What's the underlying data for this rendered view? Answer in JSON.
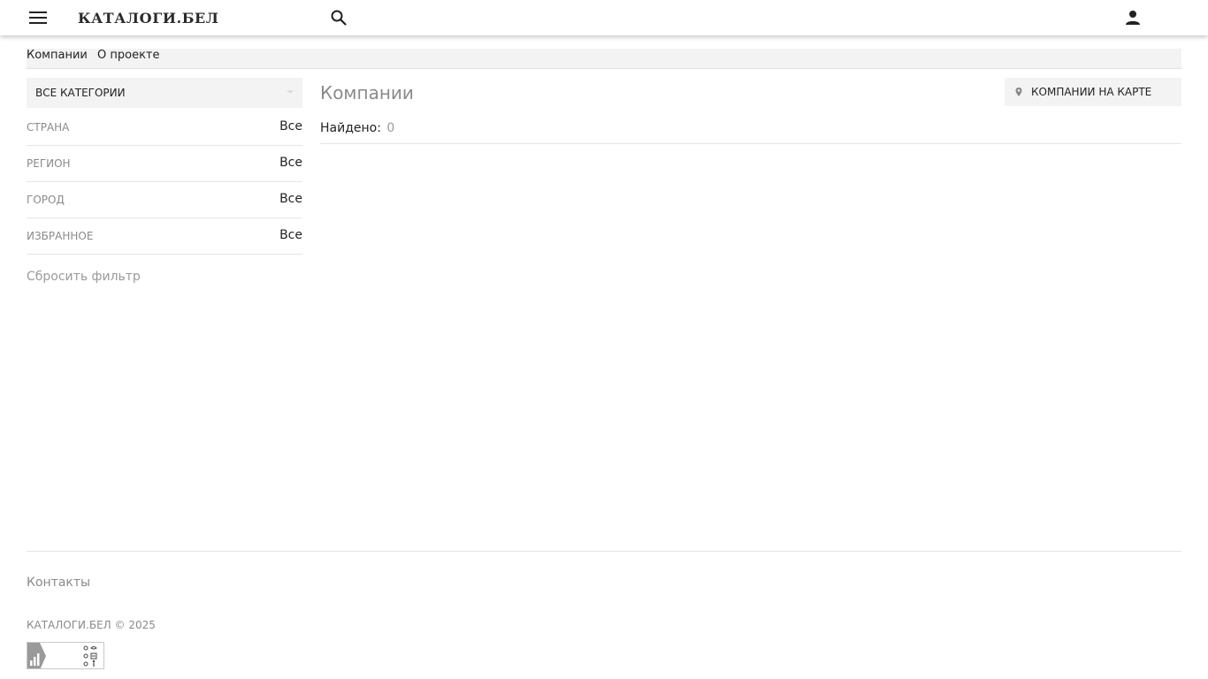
{
  "header": {
    "logo_text": "КАТАЛОГИ.БЕЛ",
    "icons": {
      "menu": "menu-icon",
      "search": "search-icon",
      "user": "user-icon"
    }
  },
  "nav": {
    "items": [
      {
        "label": "Компании"
      },
      {
        "label": "О проекте"
      }
    ]
  },
  "sidebar": {
    "categories_label": "ВСЕ КАТЕГОРИИ",
    "filters": [
      {
        "label": "СТРАНА",
        "value": "Все"
      },
      {
        "label": "РЕГИОН",
        "value": "Все"
      },
      {
        "label": "ГОРОД",
        "value": "Все"
      },
      {
        "label": "ИЗБРАННОЕ",
        "value": "Все"
      }
    ],
    "reset_label": "Сбросить фильтр"
  },
  "main": {
    "title": "Компании",
    "map_button_label": "КОМПАНИИ НА КАРТЕ",
    "found_label": "Найдено:",
    "found_count": "0"
  },
  "footer": {
    "contacts_label": "Контакты",
    "copyright": "КАТАЛОГИ.БЕЛ © 2025"
  },
  "colors": {
    "accent_bg": "#f3f3f3",
    "muted_text": "#8a8a8a",
    "divider": "#e6e6e6"
  }
}
